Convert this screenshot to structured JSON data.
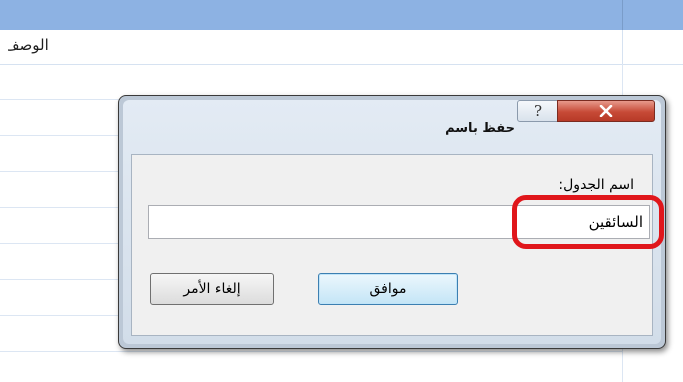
{
  "table": {
    "column_header": "الوصف"
  },
  "dialog": {
    "title": "حفظ باسم",
    "help_glyph": "?",
    "field_label": "اسم الجدول:",
    "table_name_value": "السائقين",
    "ok_label": "موافق",
    "cancel_label": "إلغاء الأمر",
    "highlight_color": "#e0161b",
    "close_button_color": "#c74a37"
  }
}
